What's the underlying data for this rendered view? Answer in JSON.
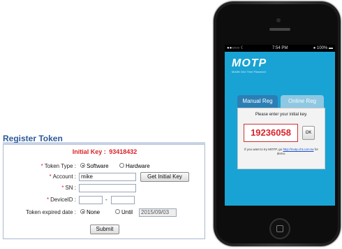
{
  "register": {
    "title": "Register Token",
    "initial_key_label": "Initial Key :",
    "initial_key_value": "93418432",
    "token_type_label": "Token Type :",
    "token_type_options": [
      "Software",
      "Hardware"
    ],
    "token_type_selected": "Software",
    "account_label": "Account :",
    "account_value": "mike",
    "get_initial_key_button": "Get Initial Key",
    "sn_label": "SN :",
    "sn_value": "",
    "device_id_label": "DeviceID :",
    "device_id_part1": "",
    "device_id_separator": "-",
    "device_id_part2": "",
    "expired_label": "Token expired date :",
    "expired_options": [
      "None",
      "Until"
    ],
    "expired_selected": "None",
    "until_date": "2015/09/03",
    "submit_button": "Submit",
    "required_marker": "*"
  },
  "phone": {
    "status_carrier": "●●○○○ ☾",
    "status_time": "7:54 PM",
    "status_battery": "● 100% ▬",
    "app_logo": "MOTP",
    "app_tagline": "Mobile One Time Password",
    "tabs": [
      "Manual Reg",
      "Online Reg"
    ],
    "active_tab": "Manual Reg",
    "prompt": "Please enter your initial key.",
    "initial_key": "19236058",
    "ok_button": "OK",
    "note_prefix": "If you want to try MOTP, go",
    "note_link": "http://motp.cht.com.tw",
    "note_suffix": "for demo."
  },
  "colors": {
    "accent_red": "#d9232a",
    "title_blue": "#2d5a9a",
    "screen_blue": "#19a3d4"
  }
}
